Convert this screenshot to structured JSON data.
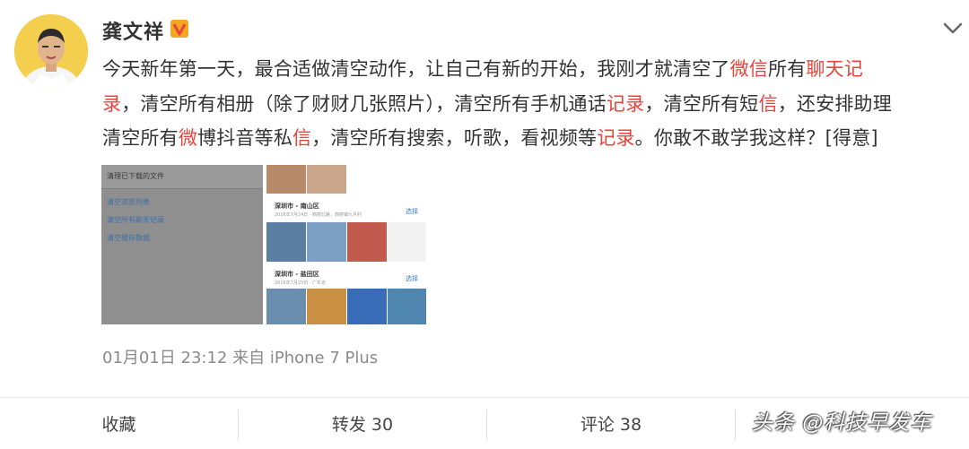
{
  "user": {
    "name": "龚文祥",
    "verified_badge": "V"
  },
  "post": {
    "lines": [
      [
        {
          "t": "今天新年第一天，最合适做清空动作，让自己有新的开始，我刚才就清空了",
          "hl": false
        },
        {
          "t": "微信",
          "hl": true
        },
        {
          "t": "所有",
          "hl": false
        },
        {
          "t": "聊天记",
          "hl": true
        }
      ],
      [
        {
          "t": "录",
          "hl": true
        },
        {
          "t": "，清空所有相册（除了财财几张照片），清空所有手机通话",
          "hl": false
        },
        {
          "t": "记录",
          "hl": true
        },
        {
          "t": "，清空所有短",
          "hl": false
        },
        {
          "t": "信",
          "hl": true
        },
        {
          "t": "，还安排助理",
          "hl": false
        }
      ],
      [
        {
          "t": "清空所有",
          "hl": false
        },
        {
          "t": "微",
          "hl": true
        },
        {
          "t": "博抖音等私",
          "hl": false
        },
        {
          "t": "信",
          "hl": true
        },
        {
          "t": "，清空所有搜索，听歌，看视频等",
          "hl": false
        },
        {
          "t": "记录",
          "hl": true
        },
        {
          "t": "。你敢不敢学我这样？[得意]",
          "hl": false
        }
      ]
    ],
    "highlight_color": "#e8443c"
  },
  "image1": {
    "header": "清理已下载的文件",
    "options": [
      "清空浏览列表",
      "清空所有聊天记录",
      "清空缓存数据"
    ]
  },
  "image2": {
    "groups": [
      {
        "location": "深圳市 - 南山区",
        "sub": "2016年7月24日 · 西丽北路，西丽镇九月村",
        "select": "选择"
      },
      {
        "location": "深圳市 - 盐田区",
        "sub": "2016年7月25日 · 广东省",
        "select": "选择"
      }
    ]
  },
  "meta": {
    "timestamp": "01月01日 23:12",
    "from_label": "来自",
    "device": "iPhone 7 Plus"
  },
  "actions": {
    "favorite": "收藏",
    "repost": "转发 30",
    "comment": "评论 38"
  },
  "watermark": "头条 @科技早发车",
  "icons": {
    "menu": "chevron-down-icon",
    "verified": "verified-v-icon",
    "avatar": "avatar"
  }
}
